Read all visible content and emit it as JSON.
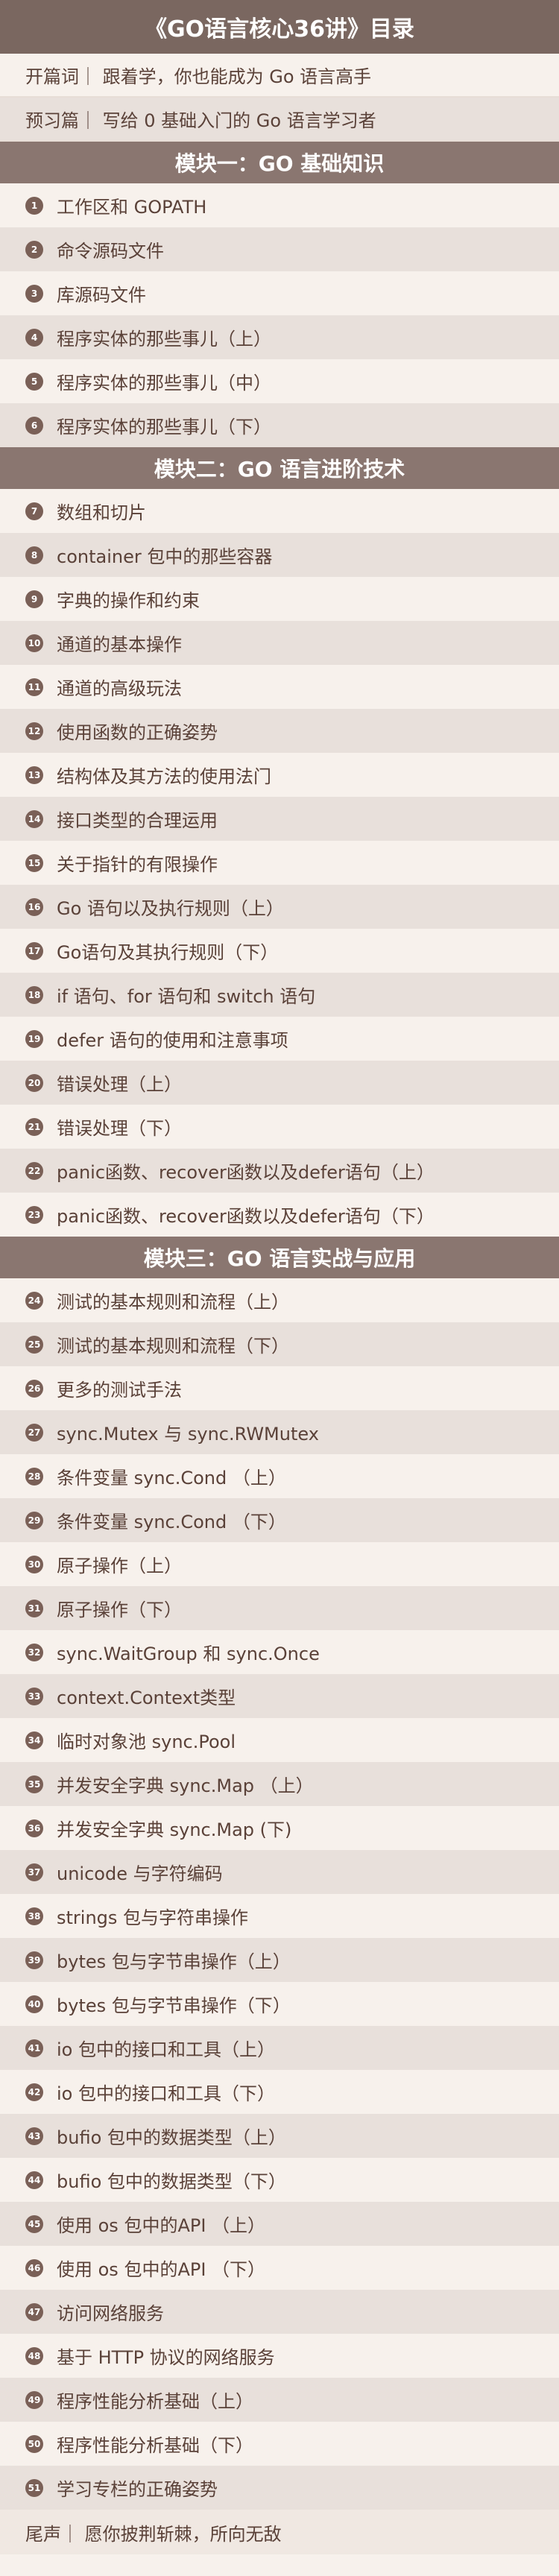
{
  "title": "《GO语言核心36讲》目录",
  "intro": [
    "开篇词｜ 跟着学，你也能成为 Go 语言高手",
    "预习篇｜ 写给 0 基础入门的 Go 语言学习者"
  ],
  "sections": [
    {
      "title": "模块一：GO 基础知识",
      "items": [
        {
          "num": "1",
          "label": "工作区和 GOPATH"
        },
        {
          "num": "2",
          "label": "命令源码文件"
        },
        {
          "num": "3",
          "label": "库源码文件"
        },
        {
          "num": "4",
          "label": "程序实体的那些事儿（上）"
        },
        {
          "num": "5",
          "label": "程序实体的那些事儿（中）"
        },
        {
          "num": "6",
          "label": "程序实体的那些事儿（下）"
        }
      ]
    },
    {
      "title": "模块二：GO 语言进阶技术",
      "items": [
        {
          "num": "7",
          "label": "数组和切片"
        },
        {
          "num": "8",
          "label": "container 包中的那些容器"
        },
        {
          "num": "9",
          "label": "字典的操作和约束"
        },
        {
          "num": "10",
          "label": "通道的基本操作"
        },
        {
          "num": "11",
          "label": "通道的高级玩法"
        },
        {
          "num": "12",
          "label": "使用函数的正确姿势"
        },
        {
          "num": "13",
          "label": "结构体及其方法的使用法门"
        },
        {
          "num": "14",
          "label": "接口类型的合理运用"
        },
        {
          "num": "15",
          "label": "关于指针的有限操作"
        },
        {
          "num": "16",
          "label": "Go 语句以及执行规则（上）"
        },
        {
          "num": "17",
          "label": "Go语句及其执行规则（下）"
        },
        {
          "num": "18",
          "label": "if 语句、for 语句和 switch 语句"
        },
        {
          "num": "19",
          "label": "defer 语句的使用和注意事项"
        },
        {
          "num": "20",
          "label": "错误处理（上）"
        },
        {
          "num": "21",
          "label": "错误处理（下）"
        },
        {
          "num": "22",
          "label": "panic函数、recover函数以及defer语句（上）"
        },
        {
          "num": "23",
          "label": "panic函数、recover函数以及defer语句（下）"
        }
      ]
    },
    {
      "title": "模块三：GO 语言实战与应用",
      "items": [
        {
          "num": "24",
          "label": "测试的基本规则和流程（上）"
        },
        {
          "num": "25",
          "label": "测试的基本规则和流程（下）"
        },
        {
          "num": "26",
          "label": "更多的测试手法"
        },
        {
          "num": "27",
          "label": "sync.Mutex 与 sync.RWMutex"
        },
        {
          "num": "28",
          "label": "条件变量 sync.Cond （上）"
        },
        {
          "num": "29",
          "label": "条件变量 sync.Cond （下）"
        },
        {
          "num": "30",
          "label": "原子操作（上）"
        },
        {
          "num": "31",
          "label": "原子操作（下）"
        },
        {
          "num": "32",
          "label": "sync.WaitGroup 和 sync.Once"
        },
        {
          "num": "33",
          "label": "context.Context类型"
        },
        {
          "num": "34",
          "label": "临时对象池 sync.Pool"
        },
        {
          "num": "35",
          "label": "并发安全字典 sync.Map （上）"
        },
        {
          "num": "36",
          "label": "并发安全字典 sync.Map (下)"
        },
        {
          "num": "37",
          "label": "unicode 与字符编码"
        },
        {
          "num": "38",
          "label": "strings 包与字符串操作"
        },
        {
          "num": "39",
          "label": "bytes 包与字节串操作（上）"
        },
        {
          "num": "40",
          "label": "bytes 包与字节串操作（下）"
        },
        {
          "num": "41",
          "label": "io 包中的接口和工具（上）"
        },
        {
          "num": "42",
          "label": "io 包中的接口和工具（下）"
        },
        {
          "num": "43",
          "label": "bufio 包中的数据类型（上）"
        },
        {
          "num": "44",
          "label": "bufio 包中的数据类型（下）"
        },
        {
          "num": "45",
          "label": "使用 os 包中的API （上）"
        },
        {
          "num": "46",
          "label": "使用 os 包中的API （下）"
        },
        {
          "num": "47",
          "label": "访问网络服务"
        },
        {
          "num": "48",
          "label": "基于 HTTP 协议的网络服务"
        },
        {
          "num": "49",
          "label": "程序性能分析基础（上）"
        },
        {
          "num": "50",
          "label": "程序性能分析基础（下）"
        },
        {
          "num": "51",
          "label": "学习专栏的正确姿势"
        }
      ]
    }
  ],
  "footer": "尾声｜ 愿你披荆斩棘，所向无敌"
}
